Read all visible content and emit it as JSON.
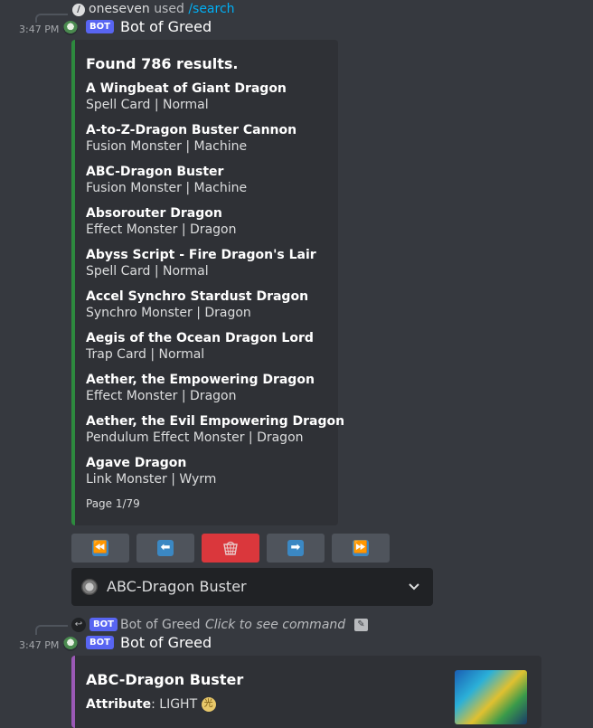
{
  "msg1": {
    "interaction_user": "oneseven",
    "interaction_used": "used",
    "interaction_command": "/search",
    "time": "3:47 PM",
    "bot_tag": "BOT",
    "author": "Bot of Greed",
    "embed": {
      "title": "Found 786 results.",
      "results": [
        {
          "name": "A Wingbeat of Giant Dragon",
          "type": "Spell Card | Normal"
        },
        {
          "name": "A-to-Z-Dragon Buster Cannon",
          "type": "Fusion Monster | Machine"
        },
        {
          "name": "ABC-Dragon Buster",
          "type": "Fusion Monster | Machine"
        },
        {
          "name": "Absorouter Dragon",
          "type": "Effect Monster | Dragon"
        },
        {
          "name": "Abyss Script - Fire Dragon's Lair",
          "type": "Spell Card | Normal"
        },
        {
          "name": "Accel Synchro Stardust Dragon",
          "type": "Synchro Monster | Dragon"
        },
        {
          "name": "Aegis of the Ocean Dragon Lord",
          "type": "Trap Card | Normal"
        },
        {
          "name": "Aether, the Empowering Dragon",
          "type": "Effect Monster | Dragon"
        },
        {
          "name": "Aether, the Evil Empowering Dragon",
          "type": "Pendulum Effect Monster | Dragon"
        },
        {
          "name": "Agave Dragon",
          "type": "Link Monster | Wyrm"
        }
      ],
      "footer": "Page 1/79",
      "accent_color": "#2d8a3e"
    },
    "buttons": [
      {
        "icon": "first-page-icon",
        "glyph": "⏪"
      },
      {
        "icon": "previous-page-icon",
        "glyph": "⬅"
      },
      {
        "icon": "trash-basket-icon",
        "glyph": ""
      },
      {
        "icon": "next-page-icon",
        "glyph": "➡"
      },
      {
        "icon": "last-page-icon",
        "glyph": "⏩"
      }
    ],
    "select": {
      "value": "ABC-Dragon Buster"
    }
  },
  "msg2": {
    "reply_author": "Bot of Greed",
    "reply_hint": "Click to see command",
    "bot_tag": "BOT",
    "time": "3:47 PM",
    "author": "Bot of Greed",
    "embed": {
      "title": "ABC-Dragon Buster",
      "attribute_label": "Attribute",
      "attribute_value": ": LIGHT",
      "accent_color": "#9b59b6"
    }
  }
}
